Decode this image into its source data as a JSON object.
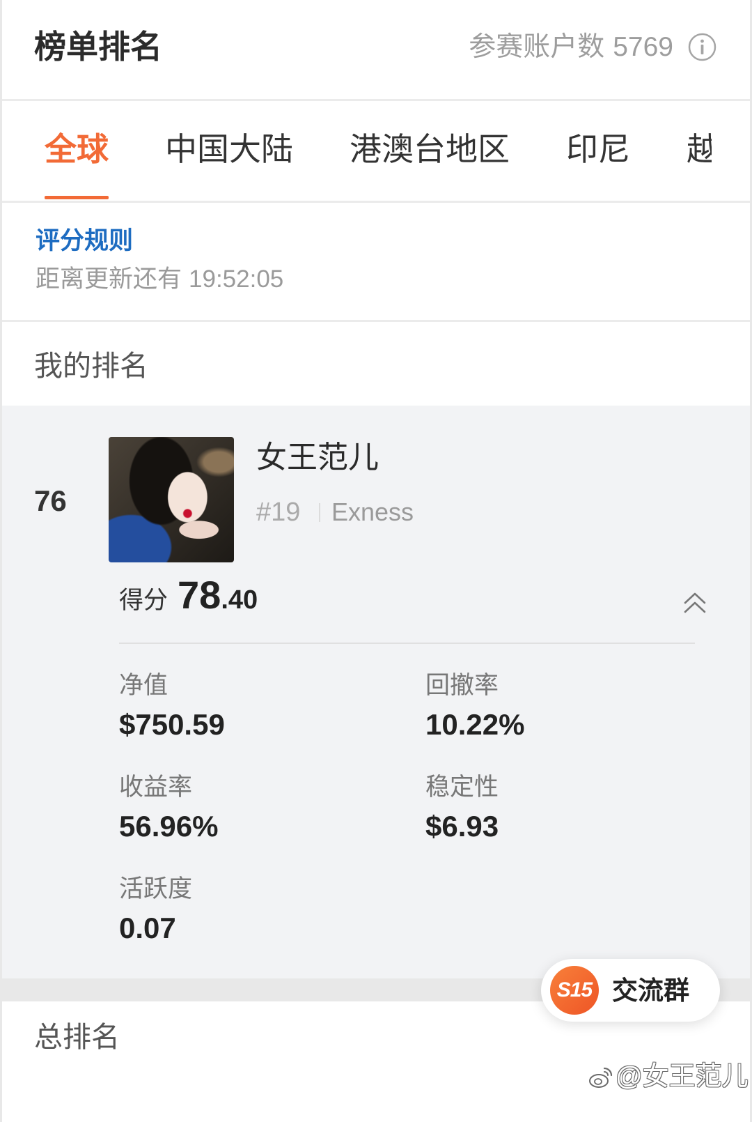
{
  "colors": {
    "accent": "#f26a36",
    "link": "#1d6cc1",
    "card_background": "#f2f3f5"
  },
  "header": {
    "title": "榜单排名",
    "participants_label": "参赛账户数",
    "participants_count": "5769",
    "info_icon": "info-circle-icon"
  },
  "tabs": [
    {
      "label": "全球",
      "active": true
    },
    {
      "label": "中国大陆",
      "active": false
    },
    {
      "label": "港澳台地区",
      "active": false
    },
    {
      "label": "印尼",
      "active": false
    },
    {
      "label": "越",
      "active": false
    }
  ],
  "rules": {
    "link_label": "评分规则",
    "countdown_label": "距离更新还有",
    "countdown_value": "19:52:05"
  },
  "my_rank": {
    "section_title": "我的排名",
    "rank": "76",
    "name": "女王范儿",
    "account_number": "#19",
    "broker": "Exness",
    "score_label": "得分",
    "score_integer": "78",
    "score_decimal": ".40",
    "expand_icon": "chevron-double-up-icon",
    "metrics": [
      {
        "label": "净值",
        "value": "$750.59"
      },
      {
        "label": "回撤率",
        "value": "10.22%"
      },
      {
        "label": "收益率",
        "value": "56.96%"
      },
      {
        "label": "稳定性",
        "value": "$6.93"
      },
      {
        "label": "活跃度",
        "value": "0.07"
      }
    ]
  },
  "total_rank": {
    "section_title": "总排名"
  },
  "chat_group_button": {
    "badge": "S15",
    "label": "交流群"
  },
  "watermark": {
    "icon": "weibo-icon",
    "text": "@女王范儿"
  }
}
